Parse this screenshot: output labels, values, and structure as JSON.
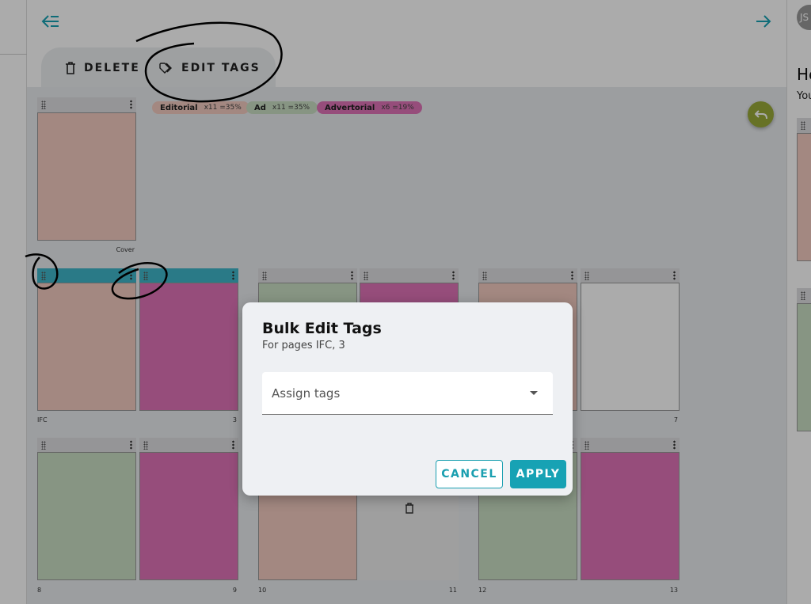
{
  "toolbar": {
    "delete_label": "DELETE",
    "edit_tags_label": "EDIT TAGS"
  },
  "tags": [
    {
      "name": "Editorial",
      "count": "x11 =35%",
      "color": "#f4cbc0"
    },
    {
      "name": "Ad",
      "count": "x11 =35%",
      "color": "#c9dfc3"
    },
    {
      "name": "Advertorial",
      "count": "x6 =19%",
      "color": "#e074b8"
    }
  ],
  "pages": {
    "cover": "Cover",
    "ifc": "IFC",
    "p3": "3",
    "p7": "7",
    "p8": "8",
    "p9": "9",
    "p10": "10",
    "p11": "11",
    "p12": "12",
    "p13": "13"
  },
  "right_panel": {
    "avatar": "JS",
    "heading": "He",
    "subtext": "You"
  },
  "dialog": {
    "title": "Bulk Edit Tags",
    "subtitle": "For pages IFC, 3",
    "select_placeholder": "Assign tags",
    "cancel": "CANCEL",
    "apply": "APPLY"
  },
  "colors": {
    "accent": "#17a2b4",
    "undo_fab": "#9aab3a",
    "editorial": "#f4cbc0",
    "ad": "#c9dfc3",
    "advertorial": "#e074b8"
  }
}
